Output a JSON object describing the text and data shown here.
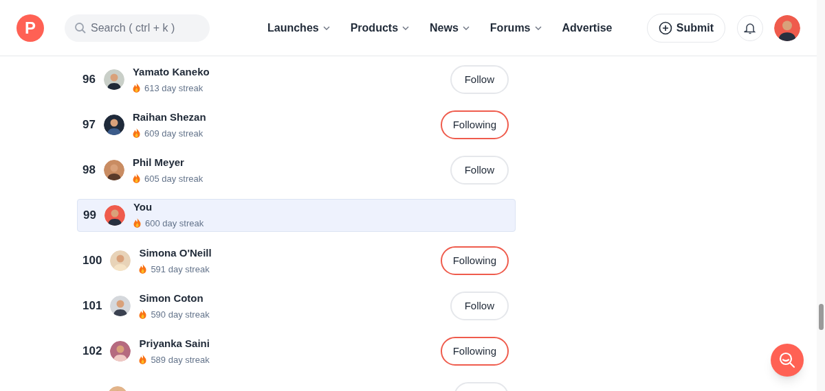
{
  "header": {
    "logo": "P",
    "search": {
      "placeholder": "Search ( ctrl + k )"
    },
    "nav": [
      {
        "label": "Launches",
        "dropdown": true
      },
      {
        "label": "Products",
        "dropdown": true
      },
      {
        "label": "News",
        "dropdown": true
      },
      {
        "label": "Forums",
        "dropdown": true
      },
      {
        "label": "Advertise",
        "dropdown": false
      }
    ],
    "submit": "Submit"
  },
  "leaderboard": [
    {
      "rank": "96",
      "name": "Yamato Kaneko",
      "streak": "613 day streak",
      "button": "Follow",
      "following": false,
      "is_you": false
    },
    {
      "rank": "97",
      "name": "Raihan Shezan",
      "streak": "609 day streak",
      "button": "Following",
      "following": true,
      "is_you": false
    },
    {
      "rank": "98",
      "name": "Phil Meyer",
      "streak": "605 day streak",
      "button": "Follow",
      "following": false,
      "is_you": false
    },
    {
      "rank": "99",
      "name": "You",
      "streak": "600 day streak",
      "is_you": true
    },
    {
      "rank": "100",
      "name": "Simona O'Neill",
      "streak": "591 day streak",
      "button": "Following",
      "following": true,
      "is_you": false
    },
    {
      "rank": "101",
      "name": "Simon Coton",
      "streak": "590 day streak",
      "button": "Follow",
      "following": false,
      "is_you": false
    },
    {
      "rank": "102",
      "name": "Priyanka Saini",
      "streak": "589 day streak",
      "button": "Following",
      "following": true,
      "is_you": false
    },
    {
      "is_you": false,
      "button_cut": true
    }
  ]
}
